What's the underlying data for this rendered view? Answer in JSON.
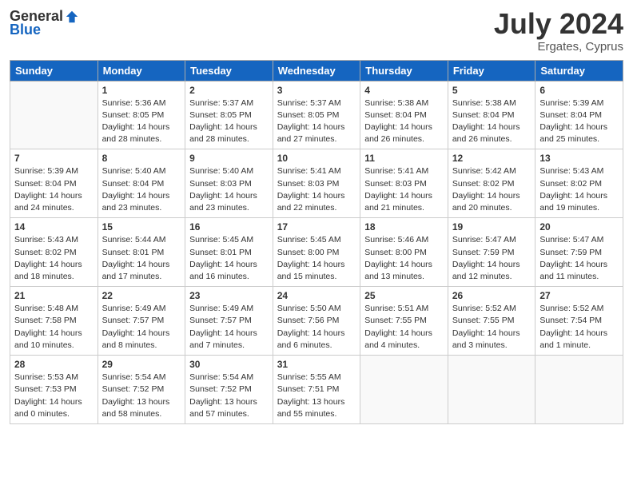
{
  "header": {
    "logo_general": "General",
    "logo_blue": "Blue",
    "month_year": "July 2024",
    "location": "Ergates, Cyprus"
  },
  "days_of_week": [
    "Sunday",
    "Monday",
    "Tuesday",
    "Wednesday",
    "Thursday",
    "Friday",
    "Saturday"
  ],
  "weeks": [
    [
      {
        "day": "",
        "lines": []
      },
      {
        "day": "1",
        "lines": [
          "Sunrise: 5:36 AM",
          "Sunset: 8:05 PM",
          "Daylight: 14 hours",
          "and 28 minutes."
        ]
      },
      {
        "day": "2",
        "lines": [
          "Sunrise: 5:37 AM",
          "Sunset: 8:05 PM",
          "Daylight: 14 hours",
          "and 28 minutes."
        ]
      },
      {
        "day": "3",
        "lines": [
          "Sunrise: 5:37 AM",
          "Sunset: 8:05 PM",
          "Daylight: 14 hours",
          "and 27 minutes."
        ]
      },
      {
        "day": "4",
        "lines": [
          "Sunrise: 5:38 AM",
          "Sunset: 8:04 PM",
          "Daylight: 14 hours",
          "and 26 minutes."
        ]
      },
      {
        "day": "5",
        "lines": [
          "Sunrise: 5:38 AM",
          "Sunset: 8:04 PM",
          "Daylight: 14 hours",
          "and 26 minutes."
        ]
      },
      {
        "day": "6",
        "lines": [
          "Sunrise: 5:39 AM",
          "Sunset: 8:04 PM",
          "Daylight: 14 hours",
          "and 25 minutes."
        ]
      }
    ],
    [
      {
        "day": "7",
        "lines": [
          "Sunrise: 5:39 AM",
          "Sunset: 8:04 PM",
          "Daylight: 14 hours",
          "and 24 minutes."
        ]
      },
      {
        "day": "8",
        "lines": [
          "Sunrise: 5:40 AM",
          "Sunset: 8:04 PM",
          "Daylight: 14 hours",
          "and 23 minutes."
        ]
      },
      {
        "day": "9",
        "lines": [
          "Sunrise: 5:40 AM",
          "Sunset: 8:03 PM",
          "Daylight: 14 hours",
          "and 23 minutes."
        ]
      },
      {
        "day": "10",
        "lines": [
          "Sunrise: 5:41 AM",
          "Sunset: 8:03 PM",
          "Daylight: 14 hours",
          "and 22 minutes."
        ]
      },
      {
        "day": "11",
        "lines": [
          "Sunrise: 5:41 AM",
          "Sunset: 8:03 PM",
          "Daylight: 14 hours",
          "and 21 minutes."
        ]
      },
      {
        "day": "12",
        "lines": [
          "Sunrise: 5:42 AM",
          "Sunset: 8:02 PM",
          "Daylight: 14 hours",
          "and 20 minutes."
        ]
      },
      {
        "day": "13",
        "lines": [
          "Sunrise: 5:43 AM",
          "Sunset: 8:02 PM",
          "Daylight: 14 hours",
          "and 19 minutes."
        ]
      }
    ],
    [
      {
        "day": "14",
        "lines": [
          "Sunrise: 5:43 AM",
          "Sunset: 8:02 PM",
          "Daylight: 14 hours",
          "and 18 minutes."
        ]
      },
      {
        "day": "15",
        "lines": [
          "Sunrise: 5:44 AM",
          "Sunset: 8:01 PM",
          "Daylight: 14 hours",
          "and 17 minutes."
        ]
      },
      {
        "day": "16",
        "lines": [
          "Sunrise: 5:45 AM",
          "Sunset: 8:01 PM",
          "Daylight: 14 hours",
          "and 16 minutes."
        ]
      },
      {
        "day": "17",
        "lines": [
          "Sunrise: 5:45 AM",
          "Sunset: 8:00 PM",
          "Daylight: 14 hours",
          "and 15 minutes."
        ]
      },
      {
        "day": "18",
        "lines": [
          "Sunrise: 5:46 AM",
          "Sunset: 8:00 PM",
          "Daylight: 14 hours",
          "and 13 minutes."
        ]
      },
      {
        "day": "19",
        "lines": [
          "Sunrise: 5:47 AM",
          "Sunset: 7:59 PM",
          "Daylight: 14 hours",
          "and 12 minutes."
        ]
      },
      {
        "day": "20",
        "lines": [
          "Sunrise: 5:47 AM",
          "Sunset: 7:59 PM",
          "Daylight: 14 hours",
          "and 11 minutes."
        ]
      }
    ],
    [
      {
        "day": "21",
        "lines": [
          "Sunrise: 5:48 AM",
          "Sunset: 7:58 PM",
          "Daylight: 14 hours",
          "and 10 minutes."
        ]
      },
      {
        "day": "22",
        "lines": [
          "Sunrise: 5:49 AM",
          "Sunset: 7:57 PM",
          "Daylight: 14 hours",
          "and 8 minutes."
        ]
      },
      {
        "day": "23",
        "lines": [
          "Sunrise: 5:49 AM",
          "Sunset: 7:57 PM",
          "Daylight: 14 hours",
          "and 7 minutes."
        ]
      },
      {
        "day": "24",
        "lines": [
          "Sunrise: 5:50 AM",
          "Sunset: 7:56 PM",
          "Daylight: 14 hours",
          "and 6 minutes."
        ]
      },
      {
        "day": "25",
        "lines": [
          "Sunrise: 5:51 AM",
          "Sunset: 7:55 PM",
          "Daylight: 14 hours",
          "and 4 minutes."
        ]
      },
      {
        "day": "26",
        "lines": [
          "Sunrise: 5:52 AM",
          "Sunset: 7:55 PM",
          "Daylight: 14 hours",
          "and 3 minutes."
        ]
      },
      {
        "day": "27",
        "lines": [
          "Sunrise: 5:52 AM",
          "Sunset: 7:54 PM",
          "Daylight: 14 hours",
          "and 1 minute."
        ]
      }
    ],
    [
      {
        "day": "28",
        "lines": [
          "Sunrise: 5:53 AM",
          "Sunset: 7:53 PM",
          "Daylight: 14 hours",
          "and 0 minutes."
        ]
      },
      {
        "day": "29",
        "lines": [
          "Sunrise: 5:54 AM",
          "Sunset: 7:52 PM",
          "Daylight: 13 hours",
          "and 58 minutes."
        ]
      },
      {
        "day": "30",
        "lines": [
          "Sunrise: 5:54 AM",
          "Sunset: 7:52 PM",
          "Daylight: 13 hours",
          "and 57 minutes."
        ]
      },
      {
        "day": "31",
        "lines": [
          "Sunrise: 5:55 AM",
          "Sunset: 7:51 PM",
          "Daylight: 13 hours",
          "and 55 minutes."
        ]
      },
      {
        "day": "",
        "lines": []
      },
      {
        "day": "",
        "lines": []
      },
      {
        "day": "",
        "lines": []
      }
    ]
  ]
}
